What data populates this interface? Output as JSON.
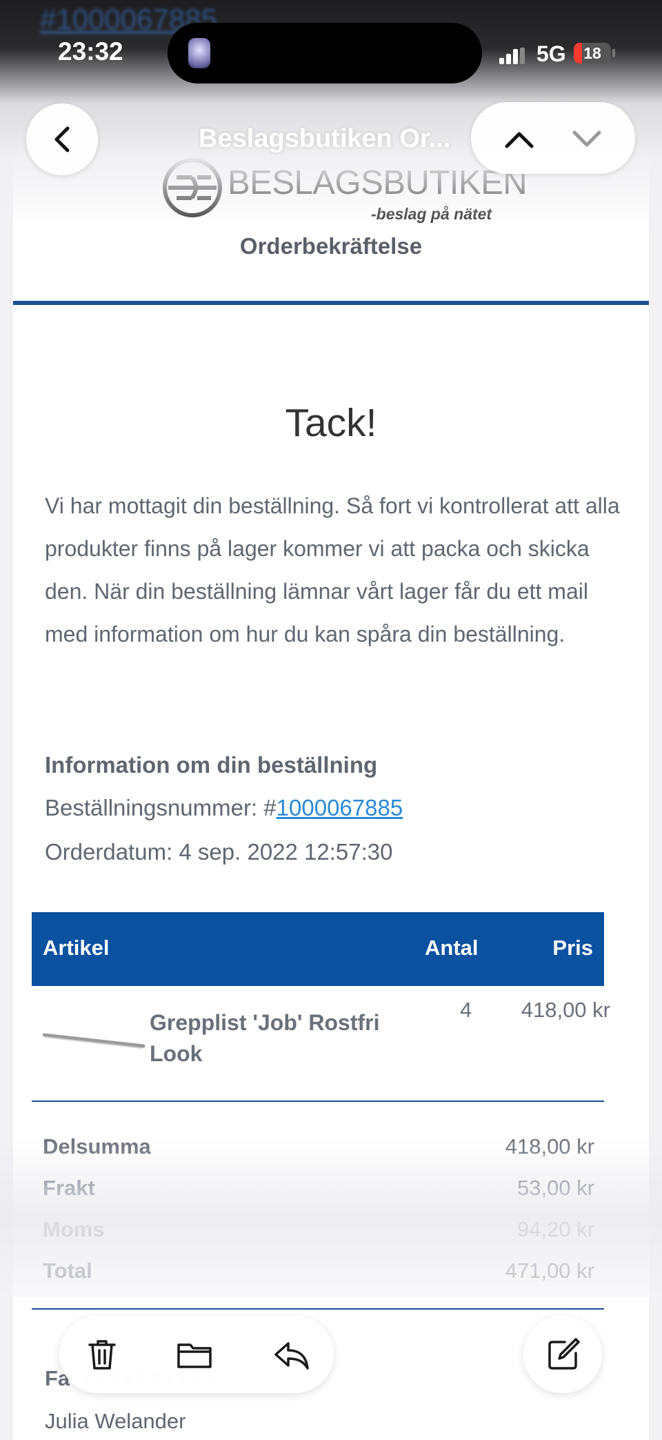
{
  "status_bar": {
    "time": "23:32",
    "network": "5G",
    "battery_level": "18"
  },
  "background_overlay": {
    "ghost_order_link": "#1000067885"
  },
  "nav": {
    "title": "Beslagsbutiken Or..."
  },
  "email": {
    "brand": {
      "name": "BESLAGSBUTIKEN",
      "tagline": "-beslag på nätet"
    },
    "subject_heading": "Orderbekräftelse",
    "thanks": "Tack!",
    "intro": "Vi har mottagit din beställning. Så fort vi kontrollerat att alla produkter finns på lager kommer vi att packa och skicka den. När din beställning lämnar vårt lager får du ett mail med information om hur du kan spåra din beställning.",
    "order_info": {
      "heading": "Information om din beställning",
      "number_label": "Beställningsnummer: #",
      "number_value": "1000067885",
      "date": "Orderdatum: 4 sep. 2022 12:57:30"
    },
    "table": {
      "headers": {
        "article": "Artikel",
        "qty": "Antal",
        "price": "Pris"
      },
      "items": [
        {
          "name": "Grepplist 'Job' Rostfri Look",
          "qty": "4",
          "price": "418,00 kr"
        }
      ]
    },
    "totals": [
      {
        "label": "Delsumma",
        "value": "418,00 kr"
      },
      {
        "label": "Frakt",
        "value": "53,00 kr"
      },
      {
        "label": "Moms",
        "value": "94,20 kr"
      },
      {
        "label": "Total",
        "value": "471,00 kr"
      }
    ],
    "billing": {
      "heading_visible": "Fa",
      "name": "Julia Welander"
    }
  },
  "colors": {
    "brand_blue": "#0a51a0",
    "rule_blue": "#1b4f92",
    "link_blue": "#2a8ad7",
    "text_gray": "#5f6670"
  },
  "toolbar": {
    "icons": [
      "trash-icon",
      "folder-icon",
      "reply-icon",
      "compose-icon"
    ]
  }
}
